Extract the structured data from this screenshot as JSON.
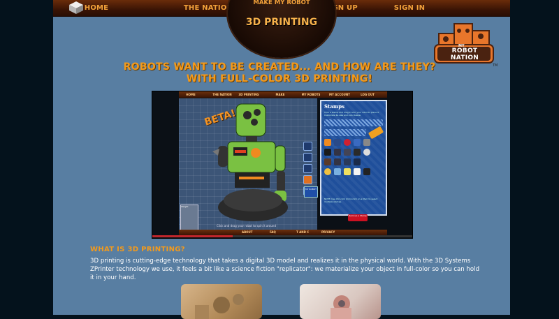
{
  "nav": {
    "home": "HOME",
    "nation": "THE NATION",
    "make_my_robot": "MAKE MY ROBOT",
    "signup": "SIGN UP",
    "signin": "SIGN IN",
    "active_tab": "3D PRINTING"
  },
  "brand": {
    "logo_text": "ROBOT NATION",
    "logo_small": "MY",
    "trademark": "TM"
  },
  "headline": {
    "line1": "ROBOTS WANT TO BE CREATED... AND HOW ARE THEY?",
    "line2": "WITH FULL-COLOR 3D PRINTING!"
  },
  "screenshot": {
    "nav_items": [
      "HOME",
      "THE NATION",
      "3D PRINTING",
      "MAKE",
      "MY ROBOTS",
      "MY ACCOUNT",
      "LOG OUT"
    ],
    "beta_label": "BETA!",
    "panel_title": "Stamps",
    "panel_desc": "Click a stamp and drag it onto your robot to place it. Customize its size and color below.",
    "panel_footer": "NOTE: Use Ctrl-click (Cmd-click on a Mac) to select multiple stamps.",
    "remove_label": "Remove a Stamp",
    "robot_button": "MY ROBOT",
    "hint_text": "Click and drag your robot to spin it around",
    "weight_label": "Weight",
    "footer_items": [
      "ABOUT",
      "FAQ",
      "T AND C",
      "PRIVACY"
    ],
    "progress": 0.31
  },
  "section": {
    "title": "WHAT IS 3D PRINTING?",
    "body": "3D printing is cutting-edge technology that takes a digital 3D model and realizes it in the physical world. With the 3D Systems ZPrinter technology we use, it feels a bit like a science fiction \"replicator\": we materialize your object in full-color so you can hold it in your hand."
  },
  "colors": {
    "accent": "#f39a1c",
    "page_bg": "#587ea2",
    "nav_bg": "#3a1405",
    "robot_green": "#7ac142"
  }
}
